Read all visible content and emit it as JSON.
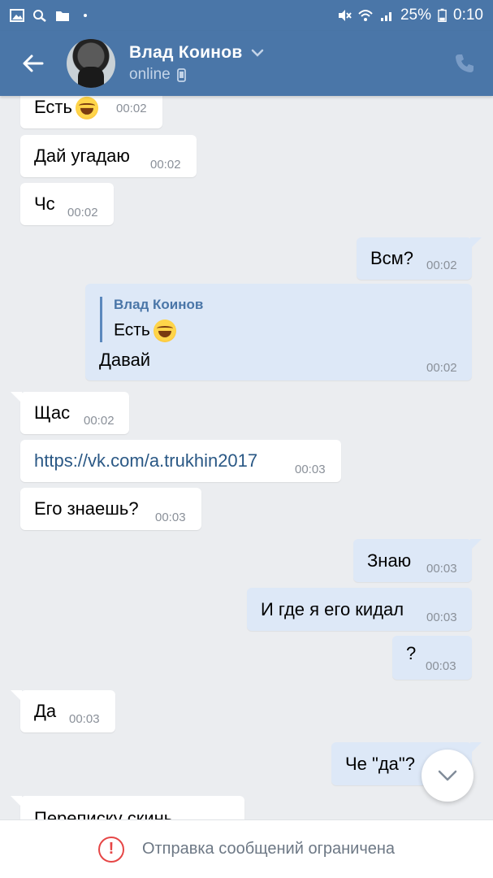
{
  "status_bar": {
    "battery": "25%",
    "time": "0:10",
    "icons_left": [
      "gallery-icon",
      "search-icon",
      "folder-icon",
      "dot-icon"
    ],
    "icons_right": [
      "mute-icon",
      "wifi-icon",
      "signal-icon",
      "battery-icon"
    ]
  },
  "header": {
    "contact_name": "Влад Коинов",
    "status": "online",
    "accent_color": "#4a76a8"
  },
  "messages": [
    {
      "dir": "in",
      "text": "Есть",
      "emoji": true,
      "time": "00:02"
    },
    {
      "dir": "in",
      "text": "Дай угадаю",
      "time": "00:02"
    },
    {
      "dir": "in",
      "text": "Чс",
      "time": "00:02"
    },
    {
      "dir": "out",
      "text": "Всм?",
      "time": "00:02"
    },
    {
      "dir": "out",
      "quote_author": "Влад Коинов",
      "quote_text": "Есть",
      "text": "Давай",
      "time": "00:02"
    },
    {
      "dir": "in",
      "text": "Щас",
      "time": "00:02"
    },
    {
      "dir": "in",
      "text": "https://vk.com/a.trukhin2017",
      "link": true,
      "time": "00:03"
    },
    {
      "dir": "in",
      "text": "Его знаешь?",
      "time": "00:03"
    },
    {
      "dir": "out",
      "text": "Знаю",
      "time": "00:03"
    },
    {
      "dir": "out",
      "text": "И где я его кидал",
      "time": "00:03"
    },
    {
      "dir": "out",
      "text": "?",
      "time": "00:03"
    },
    {
      "dir": "in",
      "text": "Да",
      "time": "00:03"
    },
    {
      "dir": "out",
      "text": "Че \"да\"?",
      "time": ""
    },
    {
      "dir": "in",
      "text": "Переписку скинь",
      "time": ""
    }
  ],
  "bottom_bar": {
    "restriction_text": "Отправка сообщений ограничена",
    "warn_color": "#e64646"
  }
}
